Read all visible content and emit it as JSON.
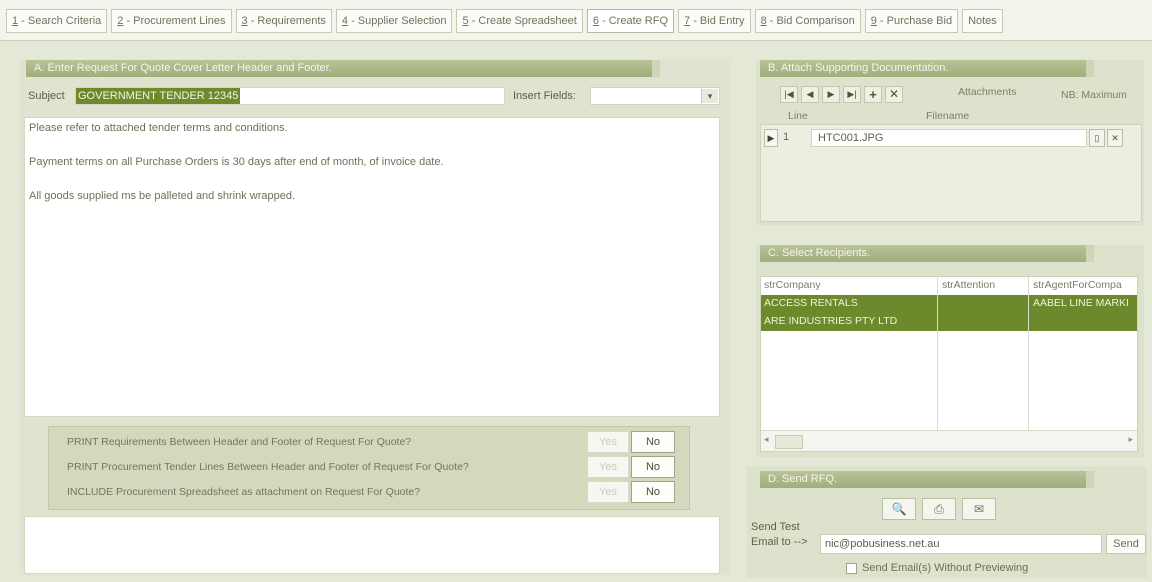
{
  "tabs": [
    {
      "num": "1",
      "label": " - Search Criteria"
    },
    {
      "num": "2",
      "label": " - Procurement Lines"
    },
    {
      "num": "3",
      "label": " - Requirements"
    },
    {
      "num": "4",
      "label": " - Supplier Selection"
    },
    {
      "num": "5",
      "label": " - Create Spreadsheet"
    },
    {
      "num": "6",
      "label": " - Create RFQ"
    },
    {
      "num": "7",
      "label": " - Bid Entry"
    },
    {
      "num": "8",
      "label": " - Bid Comparison"
    },
    {
      "num": "9",
      "label": " - Purchase Bid"
    },
    {
      "num": "",
      "label": "Notes"
    }
  ],
  "panel_a": {
    "title": "A. Enter Request For Quote Cover Letter Header and Footer.",
    "subject_label": "Subject",
    "subject_value": "GOVERNMENT TENDER 12345",
    "insert_label": "Insert Fields:",
    "insert_value": "",
    "body_lines": [
      "Please refer to attached tender terms and conditions.",
      "Payment terms on all Purchase Orders is 30 days after end of month, of invoice date.",
      "All goods supplied ms be palleted and shrink wrapped."
    ],
    "options": [
      {
        "text": "PRINT Requirements Between Header and Footer of Request For Quote?",
        "yes": "Yes",
        "no": "No"
      },
      {
        "text": "PRINT Procurement Tender Lines Between Header and Footer of Request For Quote?",
        "yes": "Yes",
        "no": "No"
      },
      {
        "text": "INCLUDE Procurement Spreadsheet as attachment on Request For Quote?",
        "yes": "Yes",
        "no": "No"
      }
    ],
    "footer_text": ""
  },
  "panel_b": {
    "title": "B. Attach Supporting Documentation.",
    "attachments_label": "Attachments",
    "note": "NB: Maximum",
    "col_line": "Line",
    "col_filename": "Filename",
    "row_line": "1",
    "row_filename": "HTC001.JPG"
  },
  "panel_c": {
    "title": "C. Select Recipients.",
    "headers": [
      "strCompany",
      "strAttention",
      "strAgentForCompa"
    ],
    "rows": [
      [
        "ACCESS RENTALS",
        "",
        "AABEL LINE MARKI"
      ],
      [
        "ARE INDUSTRIES PTY LTD",
        "",
        ""
      ]
    ]
  },
  "panel_d": {
    "title": "D. Send RFQ.",
    "send_test_label": "Send Test",
    "email_to_label": "Email to -->",
    "email_value": "nic@pobusiness.net.au",
    "send_button": "Send",
    "checkbox_label": "Send Email(s) Without Previewing"
  }
}
